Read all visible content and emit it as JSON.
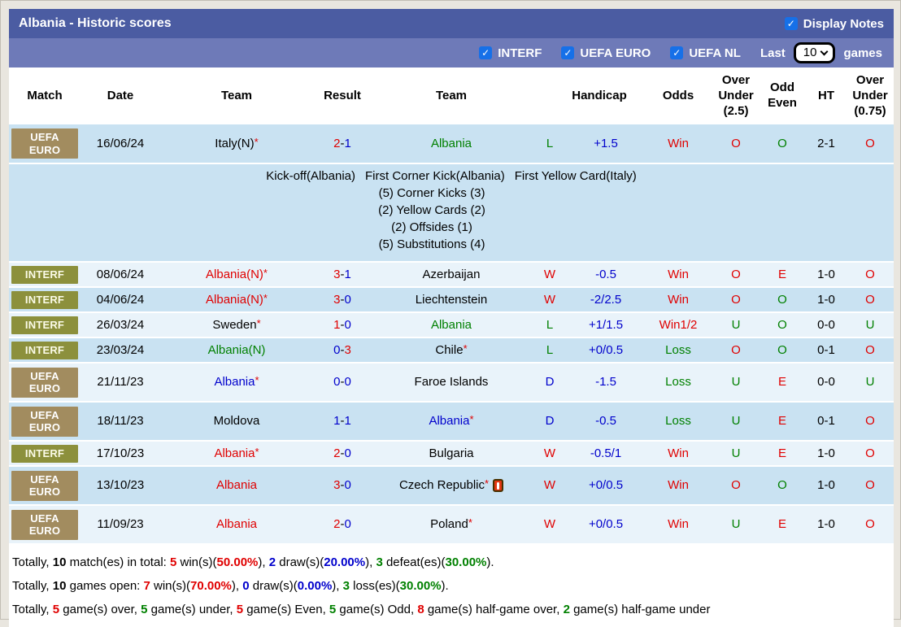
{
  "colors": {
    "accent_bar1": "#4b5ca2",
    "accent_bar2": "#6e7ab8",
    "badge_euro": "#a28c5f",
    "badge_interf": "#8c903c",
    "checkbox_blue": "#1670e8",
    "red": "#e00000",
    "blue": "#0000cc",
    "green": "#008000",
    "stripe_dark": "#c9e2f2",
    "stripe_light": "#e9f3fa"
  },
  "header": {
    "title": "Albania - Historic scores",
    "display_notes_label": "Display Notes"
  },
  "filters": {
    "items": [
      {
        "label": "INTERF",
        "checked": true
      },
      {
        "label": "UEFA EURO",
        "checked": true
      },
      {
        "label": "UEFA NL",
        "checked": true
      }
    ],
    "last_label": "Last",
    "last_value": "10",
    "games_label": "games",
    "check_glyph": "✓"
  },
  "table": {
    "columns": [
      "Match",
      "Date",
      "Team",
      "Result",
      "Team",
      "Handicap",
      "Odds",
      "Over\nUnder\n(2.5)",
      "Odd\nEven",
      "HT",
      "Over\nUnder\n(0.75)"
    ],
    "rows": [
      {
        "badge": "UEFA\nEURO",
        "badge_type": "euro",
        "tall": true,
        "date": "16/06/24",
        "home": {
          "name": "Italy(N)",
          "color": "black",
          "star": true
        },
        "score": {
          "home": "2",
          "away": "1",
          "home_color": "red",
          "away_color": "blue"
        },
        "away": {
          "name": "Albania",
          "color": "green",
          "star": false,
          "icon": false
        },
        "wld": {
          "t": "L",
          "c": "green"
        },
        "handicap": {
          "t": "+1.5",
          "c": "blue"
        },
        "odds": {
          "t": "Win",
          "c": "red"
        },
        "ou25": {
          "t": "O",
          "c": "red"
        },
        "oe": {
          "t": "O",
          "c": "green"
        },
        "ht": "2-1",
        "ou075": {
          "t": "O",
          "c": "red"
        },
        "notes": {
          "head_items": [
            "Kick-off(Albania)",
            "First Corner Kick(Albania)",
            "First Yellow Card(Italy)"
          ],
          "lines": [
            "(5) Corner Kicks (3)",
            "(2) Yellow Cards (2)",
            "(2) Offsides (1)",
            "(5) Substitutions (4)"
          ]
        }
      },
      {
        "badge": "INTERF",
        "badge_type": "interf",
        "tall": false,
        "date": "08/06/24",
        "home": {
          "name": "Albania(N)",
          "color": "red",
          "star": true
        },
        "score": {
          "home": "3",
          "away": "1",
          "home_color": "red",
          "away_color": "blue"
        },
        "away": {
          "name": "Azerbaijan",
          "color": "black",
          "star": false,
          "icon": false
        },
        "wld": {
          "t": "W",
          "c": "red"
        },
        "handicap": {
          "t": "-0.5",
          "c": "blue"
        },
        "odds": {
          "t": "Win",
          "c": "red"
        },
        "ou25": {
          "t": "O",
          "c": "red"
        },
        "oe": {
          "t": "E",
          "c": "red"
        },
        "ht": "1-0",
        "ou075": {
          "t": "O",
          "c": "red"
        }
      },
      {
        "badge": "INTERF",
        "badge_type": "interf",
        "tall": false,
        "date": "04/06/24",
        "home": {
          "name": "Albania(N)",
          "color": "red",
          "star": true
        },
        "score": {
          "home": "3",
          "away": "0",
          "home_color": "red",
          "away_color": "blue"
        },
        "away": {
          "name": "Liechtenstein",
          "color": "black",
          "star": false,
          "icon": false
        },
        "wld": {
          "t": "W",
          "c": "red"
        },
        "handicap": {
          "t": "-2/2.5",
          "c": "blue"
        },
        "odds": {
          "t": "Win",
          "c": "red"
        },
        "ou25": {
          "t": "O",
          "c": "red"
        },
        "oe": {
          "t": "O",
          "c": "green"
        },
        "ht": "1-0",
        "ou075": {
          "t": "O",
          "c": "red"
        }
      },
      {
        "badge": "INTERF",
        "badge_type": "interf",
        "tall": false,
        "date": "26/03/24",
        "home": {
          "name": "Sweden",
          "color": "black",
          "star": true
        },
        "score": {
          "home": "1",
          "away": "0",
          "home_color": "red",
          "away_color": "blue"
        },
        "away": {
          "name": "Albania",
          "color": "green",
          "star": false,
          "icon": false
        },
        "wld": {
          "t": "L",
          "c": "green"
        },
        "handicap": {
          "t": "+1/1.5",
          "c": "blue"
        },
        "odds": {
          "t": "Win1/2",
          "c": "red"
        },
        "ou25": {
          "t": "U",
          "c": "green"
        },
        "oe": {
          "t": "O",
          "c": "green"
        },
        "ht": "0-0",
        "ou075": {
          "t": "U",
          "c": "green"
        }
      },
      {
        "badge": "INTERF",
        "badge_type": "interf",
        "tall": false,
        "date": "23/03/24",
        "home": {
          "name": "Albania(N)",
          "color": "green",
          "star": false
        },
        "score": {
          "home": "0",
          "away": "3",
          "home_color": "blue",
          "away_color": "red"
        },
        "away": {
          "name": "Chile",
          "color": "black",
          "star": true,
          "icon": false
        },
        "wld": {
          "t": "L",
          "c": "green"
        },
        "handicap": {
          "t": "+0/0.5",
          "c": "blue"
        },
        "odds": {
          "t": "Loss",
          "c": "green"
        },
        "ou25": {
          "t": "O",
          "c": "red"
        },
        "oe": {
          "t": "O",
          "c": "green"
        },
        "ht": "0-1",
        "ou075": {
          "t": "O",
          "c": "red"
        }
      },
      {
        "badge": "UEFA\nEURO",
        "badge_type": "euro",
        "tall": true,
        "date": "21/11/23",
        "home": {
          "name": "Albania",
          "color": "blue",
          "star": true
        },
        "score": {
          "home": "0",
          "away": "0",
          "home_color": "blue",
          "away_color": "blue"
        },
        "away": {
          "name": "Faroe Islands",
          "color": "black",
          "star": false,
          "icon": false
        },
        "wld": {
          "t": "D",
          "c": "blue"
        },
        "handicap": {
          "t": "-1.5",
          "c": "blue"
        },
        "odds": {
          "t": "Loss",
          "c": "green"
        },
        "ou25": {
          "t": "U",
          "c": "green"
        },
        "oe": {
          "t": "E",
          "c": "red"
        },
        "ht": "0-0",
        "ou075": {
          "t": "U",
          "c": "green"
        }
      },
      {
        "badge": "UEFA\nEURO",
        "badge_type": "euro",
        "tall": true,
        "date": "18/11/23",
        "home": {
          "name": "Moldova",
          "color": "black",
          "star": false
        },
        "score": {
          "home": "1",
          "away": "1",
          "home_color": "blue",
          "away_color": "blue"
        },
        "away": {
          "name": "Albania",
          "color": "blue",
          "star": true,
          "icon": false
        },
        "wld": {
          "t": "D",
          "c": "blue"
        },
        "handicap": {
          "t": "-0.5",
          "c": "blue"
        },
        "odds": {
          "t": "Loss",
          "c": "green"
        },
        "ou25": {
          "t": "U",
          "c": "green"
        },
        "oe": {
          "t": "E",
          "c": "red"
        },
        "ht": "0-1",
        "ou075": {
          "t": "O",
          "c": "red"
        }
      },
      {
        "badge": "INTERF",
        "badge_type": "interf",
        "tall": false,
        "date": "17/10/23",
        "home": {
          "name": "Albania",
          "color": "red",
          "star": true
        },
        "score": {
          "home": "2",
          "away": "0",
          "home_color": "red",
          "away_color": "blue"
        },
        "away": {
          "name": "Bulgaria",
          "color": "black",
          "star": false,
          "icon": false
        },
        "wld": {
          "t": "W",
          "c": "red"
        },
        "handicap": {
          "t": "-0.5/1",
          "c": "blue"
        },
        "odds": {
          "t": "Win",
          "c": "red"
        },
        "ou25": {
          "t": "U",
          "c": "green"
        },
        "oe": {
          "t": "E",
          "c": "red"
        },
        "ht": "1-0",
        "ou075": {
          "t": "O",
          "c": "red"
        }
      },
      {
        "badge": "UEFA\nEURO",
        "badge_type": "euro",
        "tall": true,
        "date": "13/10/23",
        "home": {
          "name": "Albania",
          "color": "red",
          "star": false
        },
        "score": {
          "home": "3",
          "away": "0",
          "home_color": "red",
          "away_color": "blue"
        },
        "away": {
          "name": "Czech Republic",
          "color": "black",
          "star": true,
          "icon": true
        },
        "wld": {
          "t": "W",
          "c": "red"
        },
        "handicap": {
          "t": "+0/0.5",
          "c": "blue"
        },
        "odds": {
          "t": "Win",
          "c": "red"
        },
        "ou25": {
          "t": "O",
          "c": "red"
        },
        "oe": {
          "t": "O",
          "c": "green"
        },
        "ht": "1-0",
        "ou075": {
          "t": "O",
          "c": "red"
        }
      },
      {
        "badge": "UEFA\nEURO",
        "badge_type": "euro",
        "tall": true,
        "date": "11/09/23",
        "home": {
          "name": "Albania",
          "color": "red",
          "star": false
        },
        "score": {
          "home": "2",
          "away": "0",
          "home_color": "red",
          "away_color": "blue"
        },
        "away": {
          "name": "Poland",
          "color": "black",
          "star": true,
          "icon": false
        },
        "wld": {
          "t": "W",
          "c": "red"
        },
        "handicap": {
          "t": "+0/0.5",
          "c": "blue"
        },
        "odds": {
          "t": "Win",
          "c": "red"
        },
        "ou25": {
          "t": "U",
          "c": "green"
        },
        "oe": {
          "t": "E",
          "c": "red"
        },
        "ht": "1-0",
        "ou075": {
          "t": "O",
          "c": "red"
        }
      }
    ]
  },
  "footer": {
    "lines": [
      [
        {
          "t": "Totally, "
        },
        {
          "t": "10",
          "b": true
        },
        {
          "t": " match(es) in total: "
        },
        {
          "t": "5",
          "c": "red",
          "b": true
        },
        {
          "t": " win(s)("
        },
        {
          "t": "50.00%",
          "c": "red",
          "b": true
        },
        {
          "t": "), "
        },
        {
          "t": "2",
          "c": "blue",
          "b": true
        },
        {
          "t": " draw(s)("
        },
        {
          "t": "20.00%",
          "c": "blue",
          "b": true
        },
        {
          "t": "), "
        },
        {
          "t": "3",
          "c": "green",
          "b": true
        },
        {
          "t": " defeat(es)("
        },
        {
          "t": "30.00%",
          "c": "green",
          "b": true
        },
        {
          "t": ")."
        }
      ],
      [
        {
          "t": "Totally, "
        },
        {
          "t": "10",
          "b": true
        },
        {
          "t": " games open: "
        },
        {
          "t": "7",
          "c": "red",
          "b": true
        },
        {
          "t": " win(s)("
        },
        {
          "t": "70.00%",
          "c": "red",
          "b": true
        },
        {
          "t": "), "
        },
        {
          "t": "0",
          "c": "blue",
          "b": true
        },
        {
          "t": " draw(s)("
        },
        {
          "t": "0.00%",
          "c": "blue",
          "b": true
        },
        {
          "t": "), "
        },
        {
          "t": "3",
          "c": "green",
          "b": true
        },
        {
          "t": " loss(es)("
        },
        {
          "t": "30.00%",
          "c": "green",
          "b": true
        },
        {
          "t": ")."
        }
      ],
      [
        {
          "t": "Totally, "
        },
        {
          "t": "5",
          "c": "red",
          "b": true
        },
        {
          "t": " game(s) over, "
        },
        {
          "t": "5",
          "c": "green",
          "b": true
        },
        {
          "t": " game(s) under, "
        },
        {
          "t": "5",
          "c": "red",
          "b": true
        },
        {
          "t": " game(s) Even, "
        },
        {
          "t": "5",
          "c": "green",
          "b": true
        },
        {
          "t": " game(s) Odd, "
        },
        {
          "t": "8",
          "c": "red",
          "b": true
        },
        {
          "t": " game(s) half-game over, "
        },
        {
          "t": "2",
          "c": "green",
          "b": true
        },
        {
          "t": " game(s) half-game under"
        }
      ]
    ]
  }
}
